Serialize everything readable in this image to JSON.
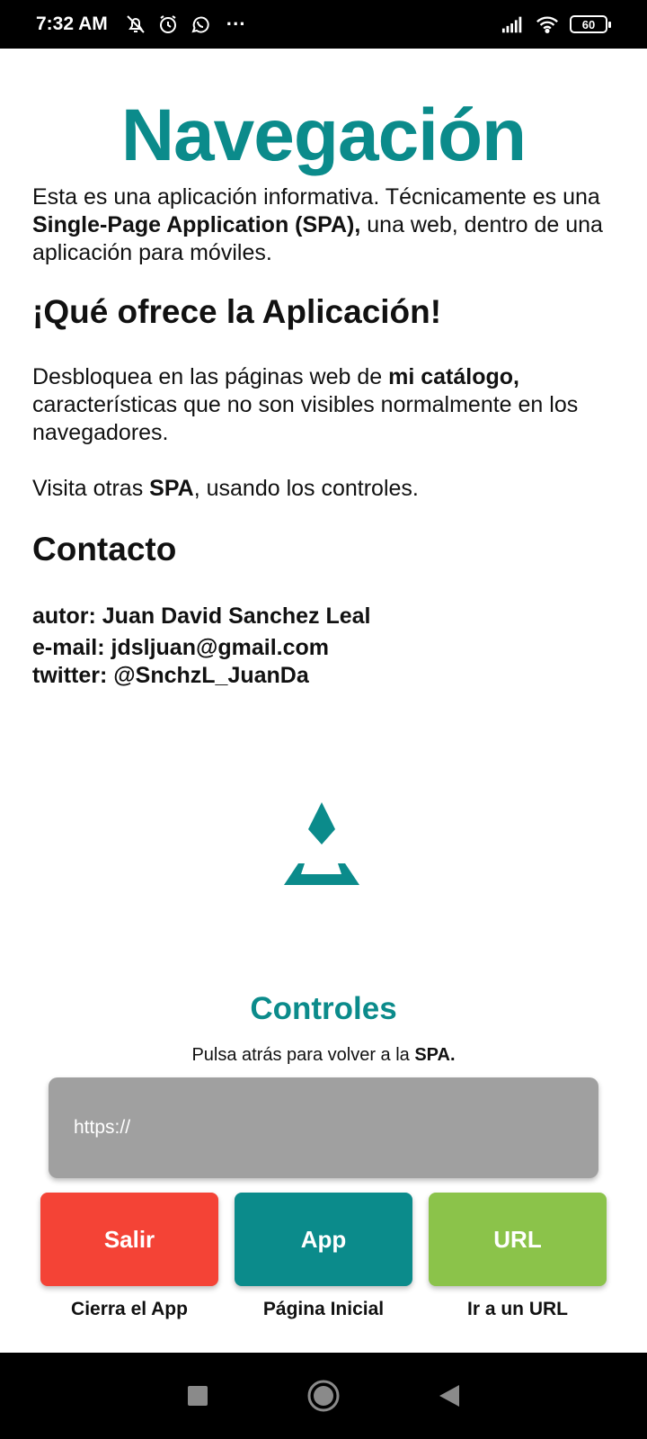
{
  "status_bar": {
    "time": "7:32 AM",
    "icons": [
      "bell-off-icon",
      "alarm-icon",
      "whatsapp-icon",
      "more-dots-icon"
    ],
    "more": "···",
    "battery": "60"
  },
  "main": {
    "title": "Navegación",
    "intro": {
      "part1": "Esta es una aplicación informativa. Técnicamente es una ",
      "bold1": "Single-Page Application (SPA),",
      "part2": " una web, dentro de una aplicación para móviles."
    },
    "offer_heading": "¡Qué ofrece la Aplicación!",
    "offer_para": {
      "part1": "Desbloquea en las páginas web de ",
      "bold1": "mi catálogo,",
      "part2": " características que no son visibles normalmente en los navegadores."
    },
    "visit_para": {
      "part1": "Visita otras ",
      "bold1": "SPA",
      "part2": ", usando los controles."
    },
    "contact_heading": "Contacto",
    "contact": {
      "author": "autor: Juan David Sanchez Leal",
      "email": "e-mail: jdsljuan@gmail.com",
      "twitter": "twitter: @SnchzL_JuanDa"
    }
  },
  "controls": {
    "title": "Controles",
    "subtitle_part1": "Pulsa atrás para volver a la ",
    "subtitle_bold": "SPA.",
    "url_placeholder": "https://",
    "buttons": [
      {
        "label": "Salir",
        "caption": "Cierra el App",
        "color": "#f44336"
      },
      {
        "label": "App",
        "caption": "Página Inicial",
        "color": "#0b8b8b"
      },
      {
        "label": "URL",
        "caption": "Ir a un URL",
        "color": "#8bc34a"
      }
    ]
  },
  "colors": {
    "accent": "#0b8b8b",
    "danger": "#f44336",
    "success": "#8bc34a",
    "input_bg": "#a0a0a0"
  },
  "nav_bar": {
    "icons": [
      "recents-square-icon",
      "home-circle-icon",
      "back-triangle-icon"
    ]
  }
}
